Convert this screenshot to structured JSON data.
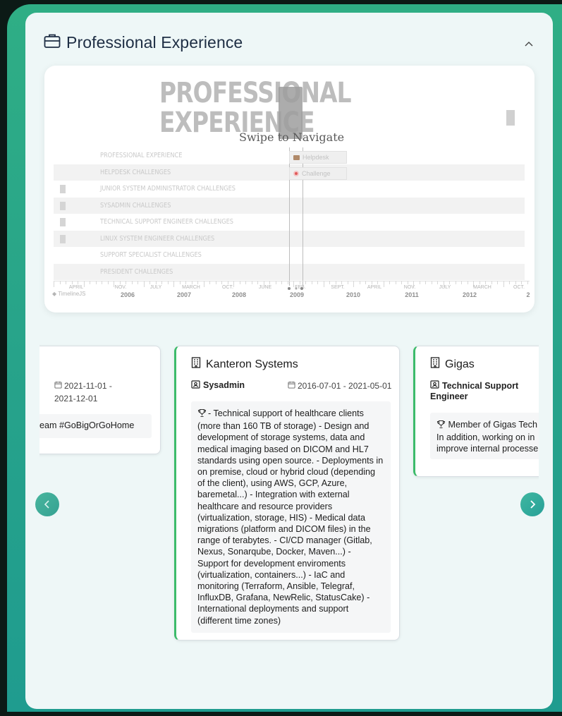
{
  "section": {
    "title": "Professional Experience",
    "icon": "briefcase-icon"
  },
  "timeline": {
    "title_line1": "PROFESSIONAL",
    "title_line2": "EXPERIENCE",
    "swipe_hint": "Swipe to Navigate",
    "rows": [
      "PROFESSIONAL EXPERIENCE",
      "HELPDESK CHALLENGES",
      "JUNIOR SYSTEM ADMINISTRATOR CHALLENGES",
      "SYSADMIN CHALLENGES",
      "TECHNICAL SUPPORT ENGINEER CHALLENGES",
      "LINUX SYSTEM ENGINEER CHALLENGES",
      "SUPPORT SPECIALIST CHALLENGES",
      "PRESIDENT CHALLENGES"
    ],
    "events": [
      {
        "label": "Helpdesk",
        "icon": "briefcase-icon"
      },
      {
        "label": "Challenge",
        "icon": "target-icon"
      }
    ],
    "months": [
      "APRIL",
      "NOV.",
      "JULY",
      "MARCH",
      "OCT.",
      "JUNE",
      "FEB.",
      "SEPT.",
      "APRIL",
      "NOV.",
      "JULY",
      "MARCH",
      "OCT."
    ],
    "years": [
      "2006",
      "2007",
      "2008",
      "2009",
      "2010",
      "2011",
      "2012",
      "2"
    ],
    "brand": "TimelineJS"
  },
  "carousel": {
    "prev_card": {
      "dates_line1": "2021-11-01 -",
      "dates_line2": "2021-12-01",
      "desc": "eam #GoBigOrGoHome"
    },
    "active_card": {
      "company": "Kanteron Systems",
      "role": "Sysadmin",
      "dates": "2016-07-01 - 2021-05-01",
      "desc": "- Technical support of healthcare clients (more than 160 TB of storage) - Design and development of storage systems, data and medical imaging based on DICOM and HL7 standards using open source. - Deployments in on premise, cloud or hybrid cloud (depending of the client), using AWS, GCP, Azure, baremetal...) - Integration with external healthcare and resource providers (virtualization, storage, HIS) - Medical data migrations (platform and DICOM files) in the range of terabytes. - CI/CD manager (Gitlab, Nexus, Sonarqube, Docker, Maven...) - Support for development enviroments (virtualization, containers...) - IaC and monitoring (Terraform, Ansible, Telegraf, InfluxDB, Grafana, NewRelic, StatusCake) - International deployments and support (different time zones)"
    },
    "next_card": {
      "company": "Gigas",
      "role_line1": "Technical Support",
      "role_line2": "Engineer",
      "desc_line1": "Member of Gigas Tech",
      "desc_line2": "In addition, working on in",
      "desc_line3": "improve internal processe"
    }
  },
  "colors": {
    "accent_green": "#3dbb6b",
    "background_gradient_top": "#2fae85",
    "card_bg": "#eef7f7",
    "title_color": "#1e2e44"
  }
}
